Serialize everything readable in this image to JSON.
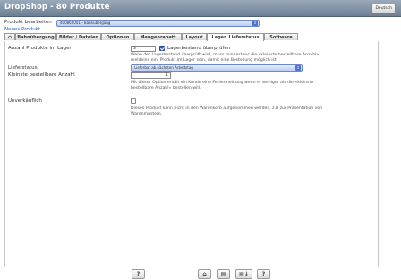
{
  "window": {
    "title": "DropShop - 80 Produkte",
    "lang_button": "Deutsch"
  },
  "header": {
    "edit_label": "Produkt bearbeiten",
    "product_select": "400860001 - Bahnübergang",
    "new_link": "Neues Produkt"
  },
  "tabs": [
    {
      "label": "Bahnübergang"
    },
    {
      "label": "Bilder / Dateien"
    },
    {
      "label": "Optionen"
    },
    {
      "label": "Mengenrabatt"
    },
    {
      "label": "Layout"
    },
    {
      "label": "Lager, Lieferstatus"
    },
    {
      "label": "Software"
    }
  ],
  "active_tab": "Lager, Lieferstatus",
  "stock": {
    "label": "Anzahl Produkte im Lager",
    "value": "3",
    "check_label": "Lagerbestand überprüfen",
    "check_on": true,
    "help": [
      "Wenn der Lagerbestand überprüft wird, muss mindestens die «kleinste bestellbare Anzahl»",
      "meldeine ein. Produkt im Lager sein, damit eine Bestellung möglich ist."
    ]
  },
  "delivery": {
    "label": "Lieferstatus",
    "select": "Lieferbar ab nächsten Arbeitstag"
  },
  "min_order": {
    "label": "Kleinste bestellbare Anzahl",
    "value": "1",
    "help": [
      "Mit dieser Option erhält ein Kunde eine Fehlermeldung wenn er weniger als die «kleinste",
      "bestellbare Anzahl» bestellen will."
    ]
  },
  "unsaleable": {
    "label": "Unverkäuflich",
    "check_on": false,
    "help": [
      "Dieses Produkt kann nicht in den Warenkorb aufgenommen werden, z.B zur Präsentation von",
      "Warenmustern."
    ]
  },
  "footer": {
    "help_btn": "?",
    "btn2": "⌂",
    "btn3": "▤",
    "btn4": "▤↓",
    "btn5": "?"
  }
}
